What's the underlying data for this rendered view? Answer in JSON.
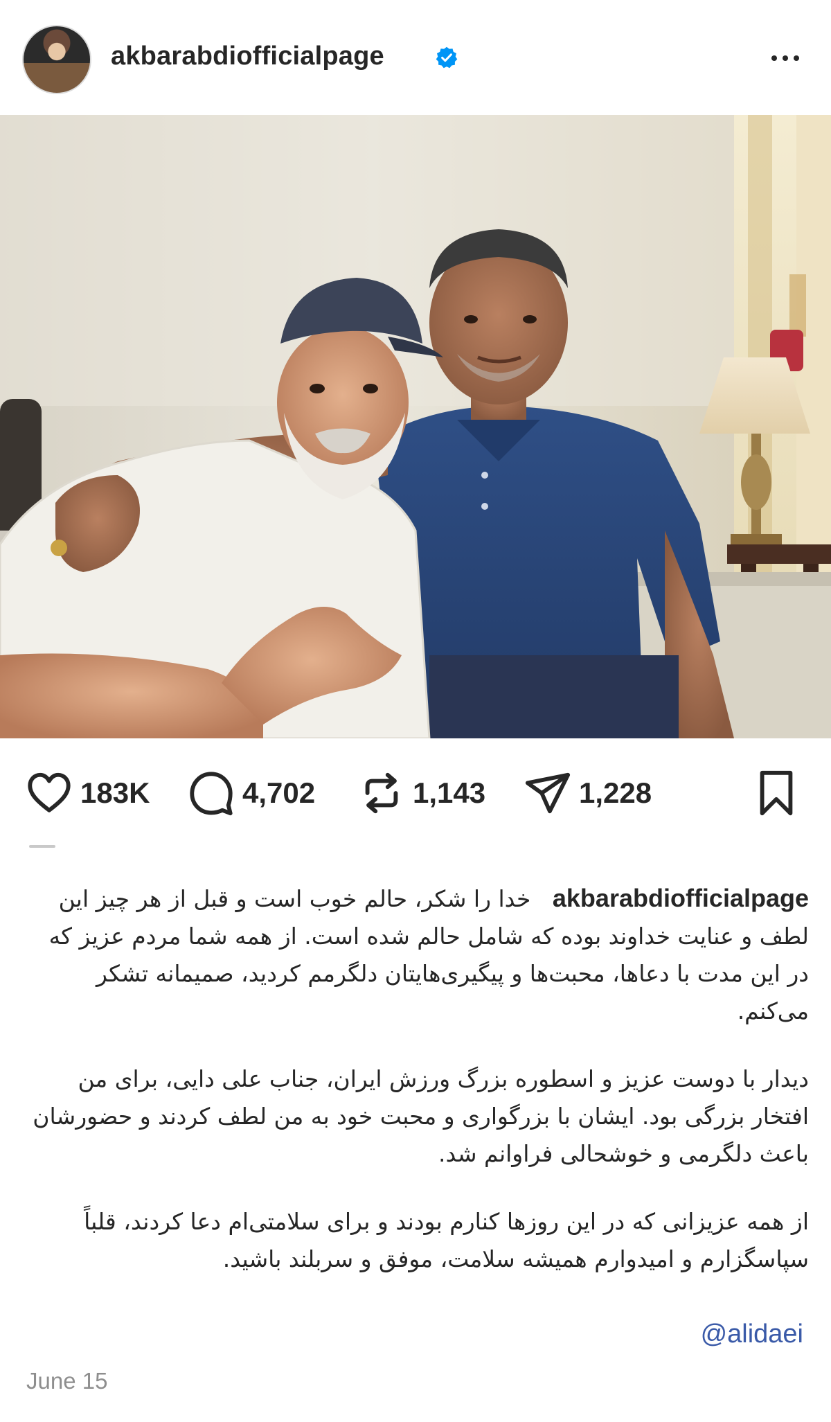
{
  "post": {
    "username": "akbarabdiofficialpage",
    "verified": true,
    "avatar_icon": "profile-avatar",
    "more_icon": "more-horizontal-icon",
    "photo_description": "Two men seated side by side in a bedroom with a table lamp"
  },
  "actions": {
    "likes": "183K",
    "comments": "4,702",
    "reposts": "1,143",
    "shares": "1,228",
    "icons": [
      "heart-icon",
      "comment-icon",
      "repost-icon",
      "share-icon",
      "bookmark-icon"
    ]
  },
  "caption": {
    "username": "akbarabdiofficialpage",
    "para1": "خدا را شکر، حالم خوب است و قبل از هر چیز این لطف و عنایت خداوند بوده که شامل حالم شده است. از همه شما مردم عزیز که در این مدت با دعاها، محبت‌ها و پیگیری‌هایتان دلگرمم کردید، صمیمانه تشکر می‌کنم.",
    "para2": "دیدار با دوست عزیز و اسطوره بزرگ ورزش ایران، جناب علی دایی، برای من افتخار بزرگی بود. ایشان با بزرگواری و محبت خود به من لطف کردند و حضورشان باعث دلگرمی و خوشحالی فراوانم شد.",
    "para3": "از همه عزیزانی که در این روزها کنارم بودند و برای سلامتی‌ام دعا کردند، قلباً سپاسگزارم و امیدوارم همیشه سلامت، موفق و سربلند باشید.",
    "mention": "@alidaei"
  },
  "date": "June 15",
  "colors": {
    "text": "#262626",
    "muted": "#8e8e8e",
    "verified": "#0095f6",
    "mention": "#3a5aa8"
  }
}
